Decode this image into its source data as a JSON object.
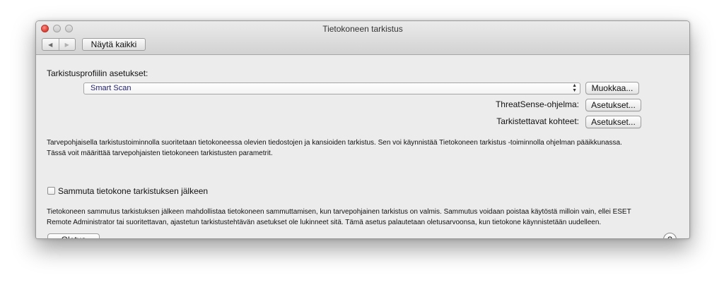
{
  "window": {
    "title": "Tietokoneen tarkistus",
    "nav_back_icon": "◀",
    "nav_forward_icon": "▶",
    "show_all_label": "Näytä kaikki"
  },
  "profile": {
    "section_label": "Tarkistusprofiilin asetukset:",
    "selected_profile": "Smart Scan",
    "edit_label": "Muokkaa..."
  },
  "threatsense": {
    "label": "ThreatSense-ohjelma:",
    "button_label": "Asetukset..."
  },
  "targets": {
    "label": "Tarkistettavat kohteet:",
    "button_label": "Asetukset..."
  },
  "descriptions": {
    "scan_line1": "Tarvepohjaisella tarkistustoiminnolla suoritetaan tietokoneessa olevien tiedostojen ja kansioiden tarkistus. Sen voi käynnistää Tietokoneen tarkistus -toiminnolla ohjelman pääikkunassa.",
    "scan_line2": "Tässä voit määrittää tarvepohjaisten tietokoneen tarkistusten parametrit.",
    "shutdown_line1": "Tietokoneen sammutus tarkistuksen jälkeen mahdollistaa tietokoneen sammuttamisen, kun tarvepohjainen tarkistus on valmis. Sammutus voidaan poistaa käytöstä milloin vain, ellei ESET",
    "shutdown_line2": "Remote Administrator tai suoritettavan, ajastetun tarkistustehtävän asetukset ole lukinneet sitä. Tämä asetus palautetaan oletusarvoonsa, kun tietokone käynnistetään uudelleen."
  },
  "shutdown": {
    "checkbox_label": "Sammuta tietokone tarkistuksen jälkeen",
    "checked": false
  },
  "footer": {
    "default_label": "Oletus",
    "help_icon": "?"
  }
}
